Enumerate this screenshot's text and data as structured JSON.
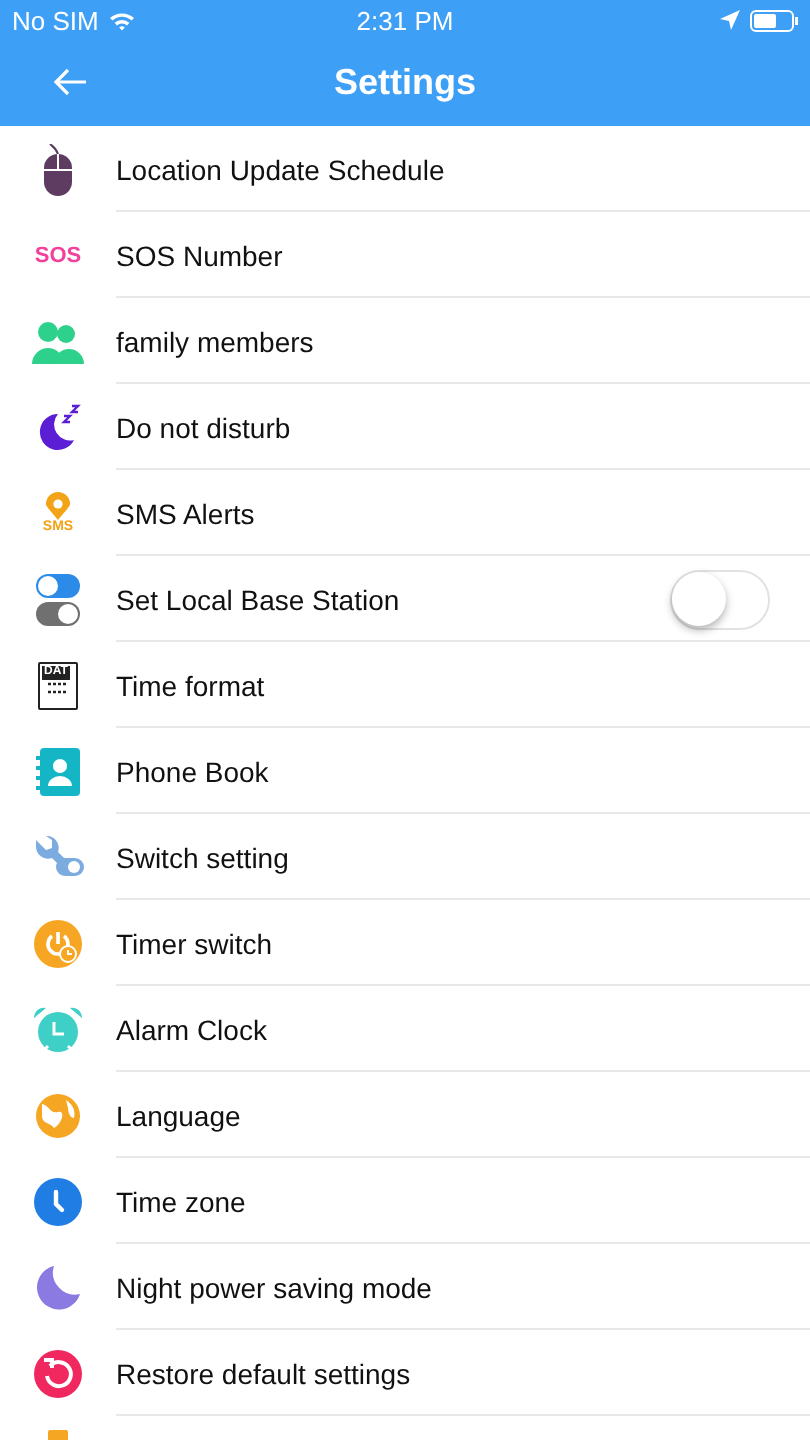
{
  "status_bar": {
    "carrier": "No SIM",
    "time": "2:31 PM"
  },
  "nav": {
    "title": "Settings"
  },
  "items": [
    {
      "label": "Location Update Schedule"
    },
    {
      "icon_text": "SOS",
      "label": "SOS Number"
    },
    {
      "label": "family members"
    },
    {
      "label": "Do not disturb"
    },
    {
      "icon_text": "SMS",
      "label": "SMS Alerts"
    },
    {
      "label": "Set Local Base Station",
      "kind": "switch",
      "on": false
    },
    {
      "icon_text": "DAT",
      "label": "Time format"
    },
    {
      "label": "Phone Book"
    },
    {
      "label": "Switch setting"
    },
    {
      "label": "Timer switch"
    },
    {
      "label": "Alarm Clock"
    },
    {
      "label": "Language"
    },
    {
      "label": "Time zone"
    },
    {
      "label": "Night power saving mode"
    },
    {
      "label": "Restore default settings"
    },
    {
      "kind": "partial"
    }
  ]
}
